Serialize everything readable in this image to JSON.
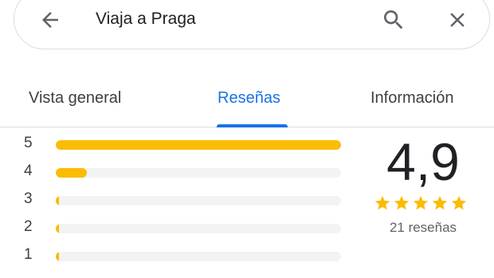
{
  "search": {
    "query": "Viaja a Praga"
  },
  "tabs": [
    {
      "label": "Vista general"
    },
    {
      "label": "Reseñas"
    },
    {
      "label": "Información"
    }
  ],
  "rating_bars": [
    {
      "stars": "5",
      "share": 1.0
    },
    {
      "stars": "4",
      "share": 0.11
    },
    {
      "stars": "3",
      "share": 0.01
    },
    {
      "stars": "2",
      "share": 0.01
    },
    {
      "stars": "1",
      "share": 0.01
    }
  ],
  "summary": {
    "score": "4,9",
    "star_count": 5,
    "reviews": "21 reseñas"
  },
  "colors": {
    "accent": "#1a73e8",
    "star": "#fbbc04",
    "bar_track": "#f1f3f4"
  },
  "icons": {
    "back": "arrow-back-icon",
    "search": "search-icon",
    "close": "close-icon",
    "star": "star-icon"
  }
}
